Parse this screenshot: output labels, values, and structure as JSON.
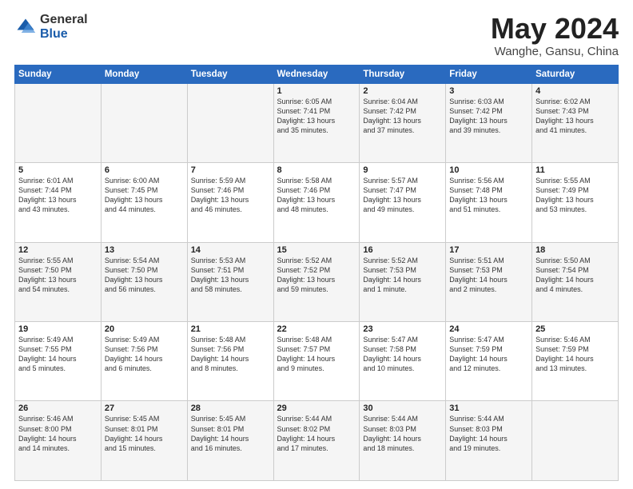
{
  "logo": {
    "general": "General",
    "blue": "Blue"
  },
  "title": {
    "month": "May 2024",
    "location": "Wanghe, Gansu, China"
  },
  "header_days": [
    "Sunday",
    "Monday",
    "Tuesday",
    "Wednesday",
    "Thursday",
    "Friday",
    "Saturday"
  ],
  "weeks": [
    [
      {
        "day": "",
        "info": ""
      },
      {
        "day": "",
        "info": ""
      },
      {
        "day": "",
        "info": ""
      },
      {
        "day": "1",
        "info": "Sunrise: 6:05 AM\nSunset: 7:41 PM\nDaylight: 13 hours\nand 35 minutes."
      },
      {
        "day": "2",
        "info": "Sunrise: 6:04 AM\nSunset: 7:42 PM\nDaylight: 13 hours\nand 37 minutes."
      },
      {
        "day": "3",
        "info": "Sunrise: 6:03 AM\nSunset: 7:42 PM\nDaylight: 13 hours\nand 39 minutes."
      },
      {
        "day": "4",
        "info": "Sunrise: 6:02 AM\nSunset: 7:43 PM\nDaylight: 13 hours\nand 41 minutes."
      }
    ],
    [
      {
        "day": "5",
        "info": "Sunrise: 6:01 AM\nSunset: 7:44 PM\nDaylight: 13 hours\nand 43 minutes."
      },
      {
        "day": "6",
        "info": "Sunrise: 6:00 AM\nSunset: 7:45 PM\nDaylight: 13 hours\nand 44 minutes."
      },
      {
        "day": "7",
        "info": "Sunrise: 5:59 AM\nSunset: 7:46 PM\nDaylight: 13 hours\nand 46 minutes."
      },
      {
        "day": "8",
        "info": "Sunrise: 5:58 AM\nSunset: 7:46 PM\nDaylight: 13 hours\nand 48 minutes."
      },
      {
        "day": "9",
        "info": "Sunrise: 5:57 AM\nSunset: 7:47 PM\nDaylight: 13 hours\nand 49 minutes."
      },
      {
        "day": "10",
        "info": "Sunrise: 5:56 AM\nSunset: 7:48 PM\nDaylight: 13 hours\nand 51 minutes."
      },
      {
        "day": "11",
        "info": "Sunrise: 5:55 AM\nSunset: 7:49 PM\nDaylight: 13 hours\nand 53 minutes."
      }
    ],
    [
      {
        "day": "12",
        "info": "Sunrise: 5:55 AM\nSunset: 7:50 PM\nDaylight: 13 hours\nand 54 minutes."
      },
      {
        "day": "13",
        "info": "Sunrise: 5:54 AM\nSunset: 7:50 PM\nDaylight: 13 hours\nand 56 minutes."
      },
      {
        "day": "14",
        "info": "Sunrise: 5:53 AM\nSunset: 7:51 PM\nDaylight: 13 hours\nand 58 minutes."
      },
      {
        "day": "15",
        "info": "Sunrise: 5:52 AM\nSunset: 7:52 PM\nDaylight: 13 hours\nand 59 minutes."
      },
      {
        "day": "16",
        "info": "Sunrise: 5:52 AM\nSunset: 7:53 PM\nDaylight: 14 hours\nand 1 minute."
      },
      {
        "day": "17",
        "info": "Sunrise: 5:51 AM\nSunset: 7:53 PM\nDaylight: 14 hours\nand 2 minutes."
      },
      {
        "day": "18",
        "info": "Sunrise: 5:50 AM\nSunset: 7:54 PM\nDaylight: 14 hours\nand 4 minutes."
      }
    ],
    [
      {
        "day": "19",
        "info": "Sunrise: 5:49 AM\nSunset: 7:55 PM\nDaylight: 14 hours\nand 5 minutes."
      },
      {
        "day": "20",
        "info": "Sunrise: 5:49 AM\nSunset: 7:56 PM\nDaylight: 14 hours\nand 6 minutes."
      },
      {
        "day": "21",
        "info": "Sunrise: 5:48 AM\nSunset: 7:56 PM\nDaylight: 14 hours\nand 8 minutes."
      },
      {
        "day": "22",
        "info": "Sunrise: 5:48 AM\nSunset: 7:57 PM\nDaylight: 14 hours\nand 9 minutes."
      },
      {
        "day": "23",
        "info": "Sunrise: 5:47 AM\nSunset: 7:58 PM\nDaylight: 14 hours\nand 10 minutes."
      },
      {
        "day": "24",
        "info": "Sunrise: 5:47 AM\nSunset: 7:59 PM\nDaylight: 14 hours\nand 12 minutes."
      },
      {
        "day": "25",
        "info": "Sunrise: 5:46 AM\nSunset: 7:59 PM\nDaylight: 14 hours\nand 13 minutes."
      }
    ],
    [
      {
        "day": "26",
        "info": "Sunrise: 5:46 AM\nSunset: 8:00 PM\nDaylight: 14 hours\nand 14 minutes."
      },
      {
        "day": "27",
        "info": "Sunrise: 5:45 AM\nSunset: 8:01 PM\nDaylight: 14 hours\nand 15 minutes."
      },
      {
        "day": "28",
        "info": "Sunrise: 5:45 AM\nSunset: 8:01 PM\nDaylight: 14 hours\nand 16 minutes."
      },
      {
        "day": "29",
        "info": "Sunrise: 5:44 AM\nSunset: 8:02 PM\nDaylight: 14 hours\nand 17 minutes."
      },
      {
        "day": "30",
        "info": "Sunrise: 5:44 AM\nSunset: 8:03 PM\nDaylight: 14 hours\nand 18 minutes."
      },
      {
        "day": "31",
        "info": "Sunrise: 5:44 AM\nSunset: 8:03 PM\nDaylight: 14 hours\nand 19 minutes."
      },
      {
        "day": "",
        "info": ""
      }
    ]
  ]
}
